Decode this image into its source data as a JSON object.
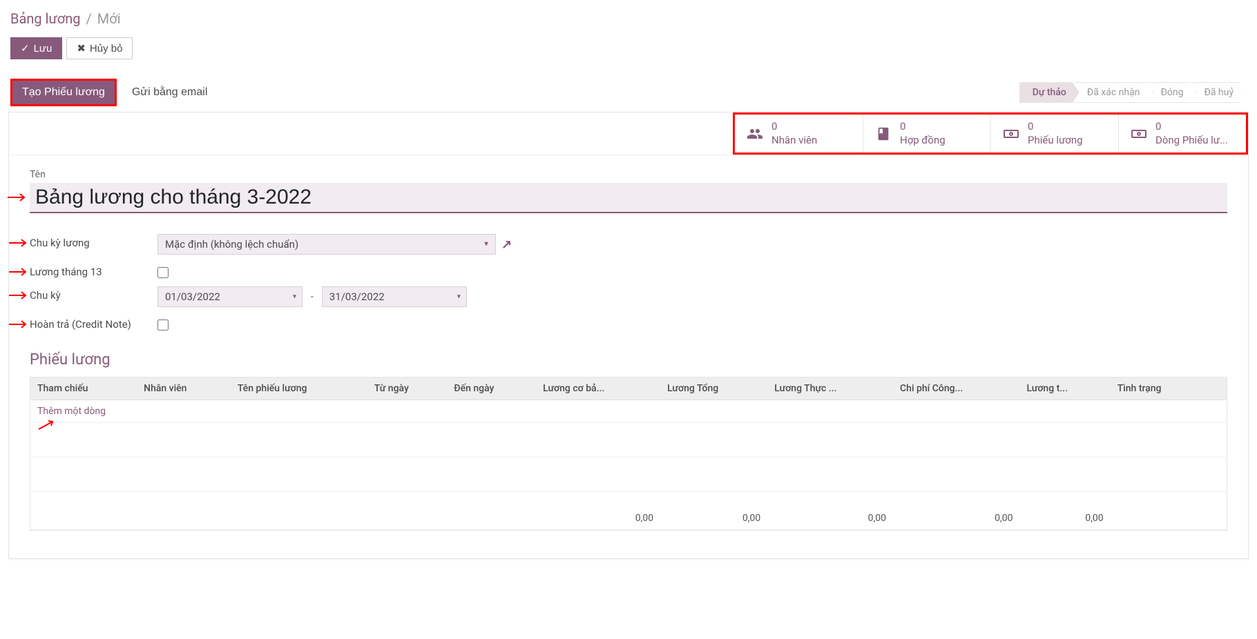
{
  "breadcrumb": {
    "parent": "Bảng lương",
    "current": "Mới"
  },
  "toolbar": {
    "save_label": "Lưu",
    "discard_label": "Hủy bỏ"
  },
  "actions": {
    "create_payslip_label": "Tạo Phiếu lương",
    "send_email_label": "Gửi bằng email"
  },
  "status_steps": [
    "Dự thảo",
    "Đã xác nhận",
    "Đóng",
    "Đã huỷ"
  ],
  "stat_buttons": [
    {
      "value": "0",
      "label": "Nhân viên",
      "icon": "users"
    },
    {
      "value": "0",
      "label": "Hợp đồng",
      "icon": "book"
    },
    {
      "value": "0",
      "label": "Phiếu lương",
      "icon": "money"
    },
    {
      "value": "0",
      "label": "Dòng Phiếu lư...",
      "icon": "money"
    }
  ],
  "form": {
    "title_label": "Tên",
    "title_value": "Bảng lương cho tháng 3-2022",
    "salary_cycle_label": "Chu kỳ lương",
    "salary_cycle_value": "Mặc định (không lệch chuẩn)",
    "month13_label": "Lương tháng 13",
    "period_label": "Chu kỳ",
    "date_from": "01/03/2022",
    "date_to": "31/03/2022",
    "credit_note_label": "Hoàn trả (Credit Note)"
  },
  "payslip_section": {
    "title": "Phiếu lương",
    "columns": [
      "Tham chiếu",
      "Nhân viên",
      "Tên phiếu lương",
      "Từ ngày",
      "Đến ngày",
      "Lương cơ bả...",
      "Lương Tổng",
      "Lương Thực ...",
      "Chi phí Công...",
      "Lương t...",
      "Tình trạng"
    ],
    "add_line_label": "Thêm một dòng",
    "totals": [
      "0,00",
      "0,00",
      "0,00",
      "0,00",
      "0,00"
    ]
  }
}
